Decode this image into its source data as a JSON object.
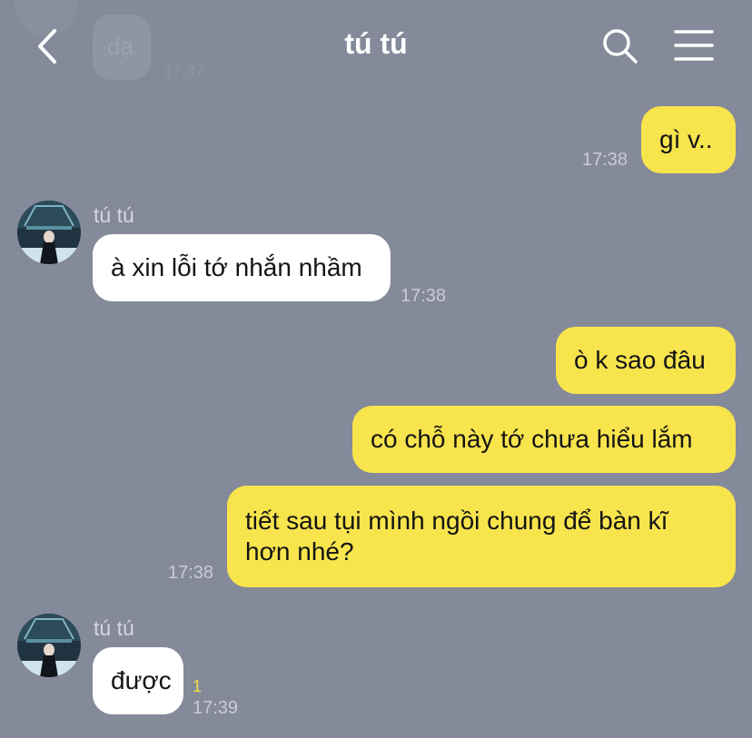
{
  "header": {
    "title": "tú tú",
    "previous_message": {
      "text": "dạ",
      "time": "17:37"
    }
  },
  "messages": [
    {
      "from": "me",
      "text": "gì v..",
      "time": "17:38"
    },
    {
      "from": "them",
      "sender": "tú tú",
      "text": "à xin lỗi tớ nhắn nhầm",
      "time": "17:38"
    },
    {
      "from": "me",
      "text": "ò k sao đâu"
    },
    {
      "from": "me",
      "text": "có chỗ này tớ chưa hiểu lắm"
    },
    {
      "from": "me",
      "text_line1": "tiết sau tụi mình ngồi chung để bàn kĩ",
      "text_line2": "hơn nhé?",
      "time": "17:38"
    },
    {
      "from": "them",
      "sender": "tú tú",
      "text": "được",
      "unread": "1",
      "time": "17:39"
    }
  ],
  "icons": {
    "back": "chevron-left-icon",
    "search": "search-icon",
    "menu": "hamburger-menu-icon"
  },
  "colors": {
    "background": "#848a99",
    "my_bubble": "#f8e44d",
    "their_bubble": "#ffffff",
    "unread": "#f4dd48"
  }
}
